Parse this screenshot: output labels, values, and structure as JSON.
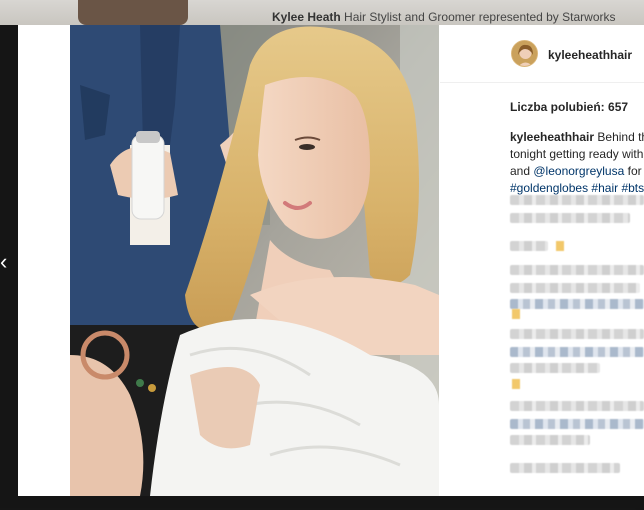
{
  "background": {
    "header_name": "Kylee Heath",
    "header_rest": "Hair Stylist and Groomer represented by Starworks"
  },
  "nav": {
    "prev_icon": "‹"
  },
  "post": {
    "username": "kyleeheathhair",
    "likes_label": "Liczba polubień:",
    "likes_count": "657",
    "caption": {
      "user": "kyleeheathhair",
      "text_1": "Behind the",
      "text_2": "tonight getting ready with",
      "text_3": "and",
      "mention": "@leonorgreylusa",
      "text_4": "for t",
      "hashtag_1": "#goldenglobes",
      "hashtag_2": "#hair",
      "hashtag_3": "#bts"
    }
  },
  "colors": {
    "link": "#003569",
    "text": "#262626",
    "overlay": "#141414"
  }
}
